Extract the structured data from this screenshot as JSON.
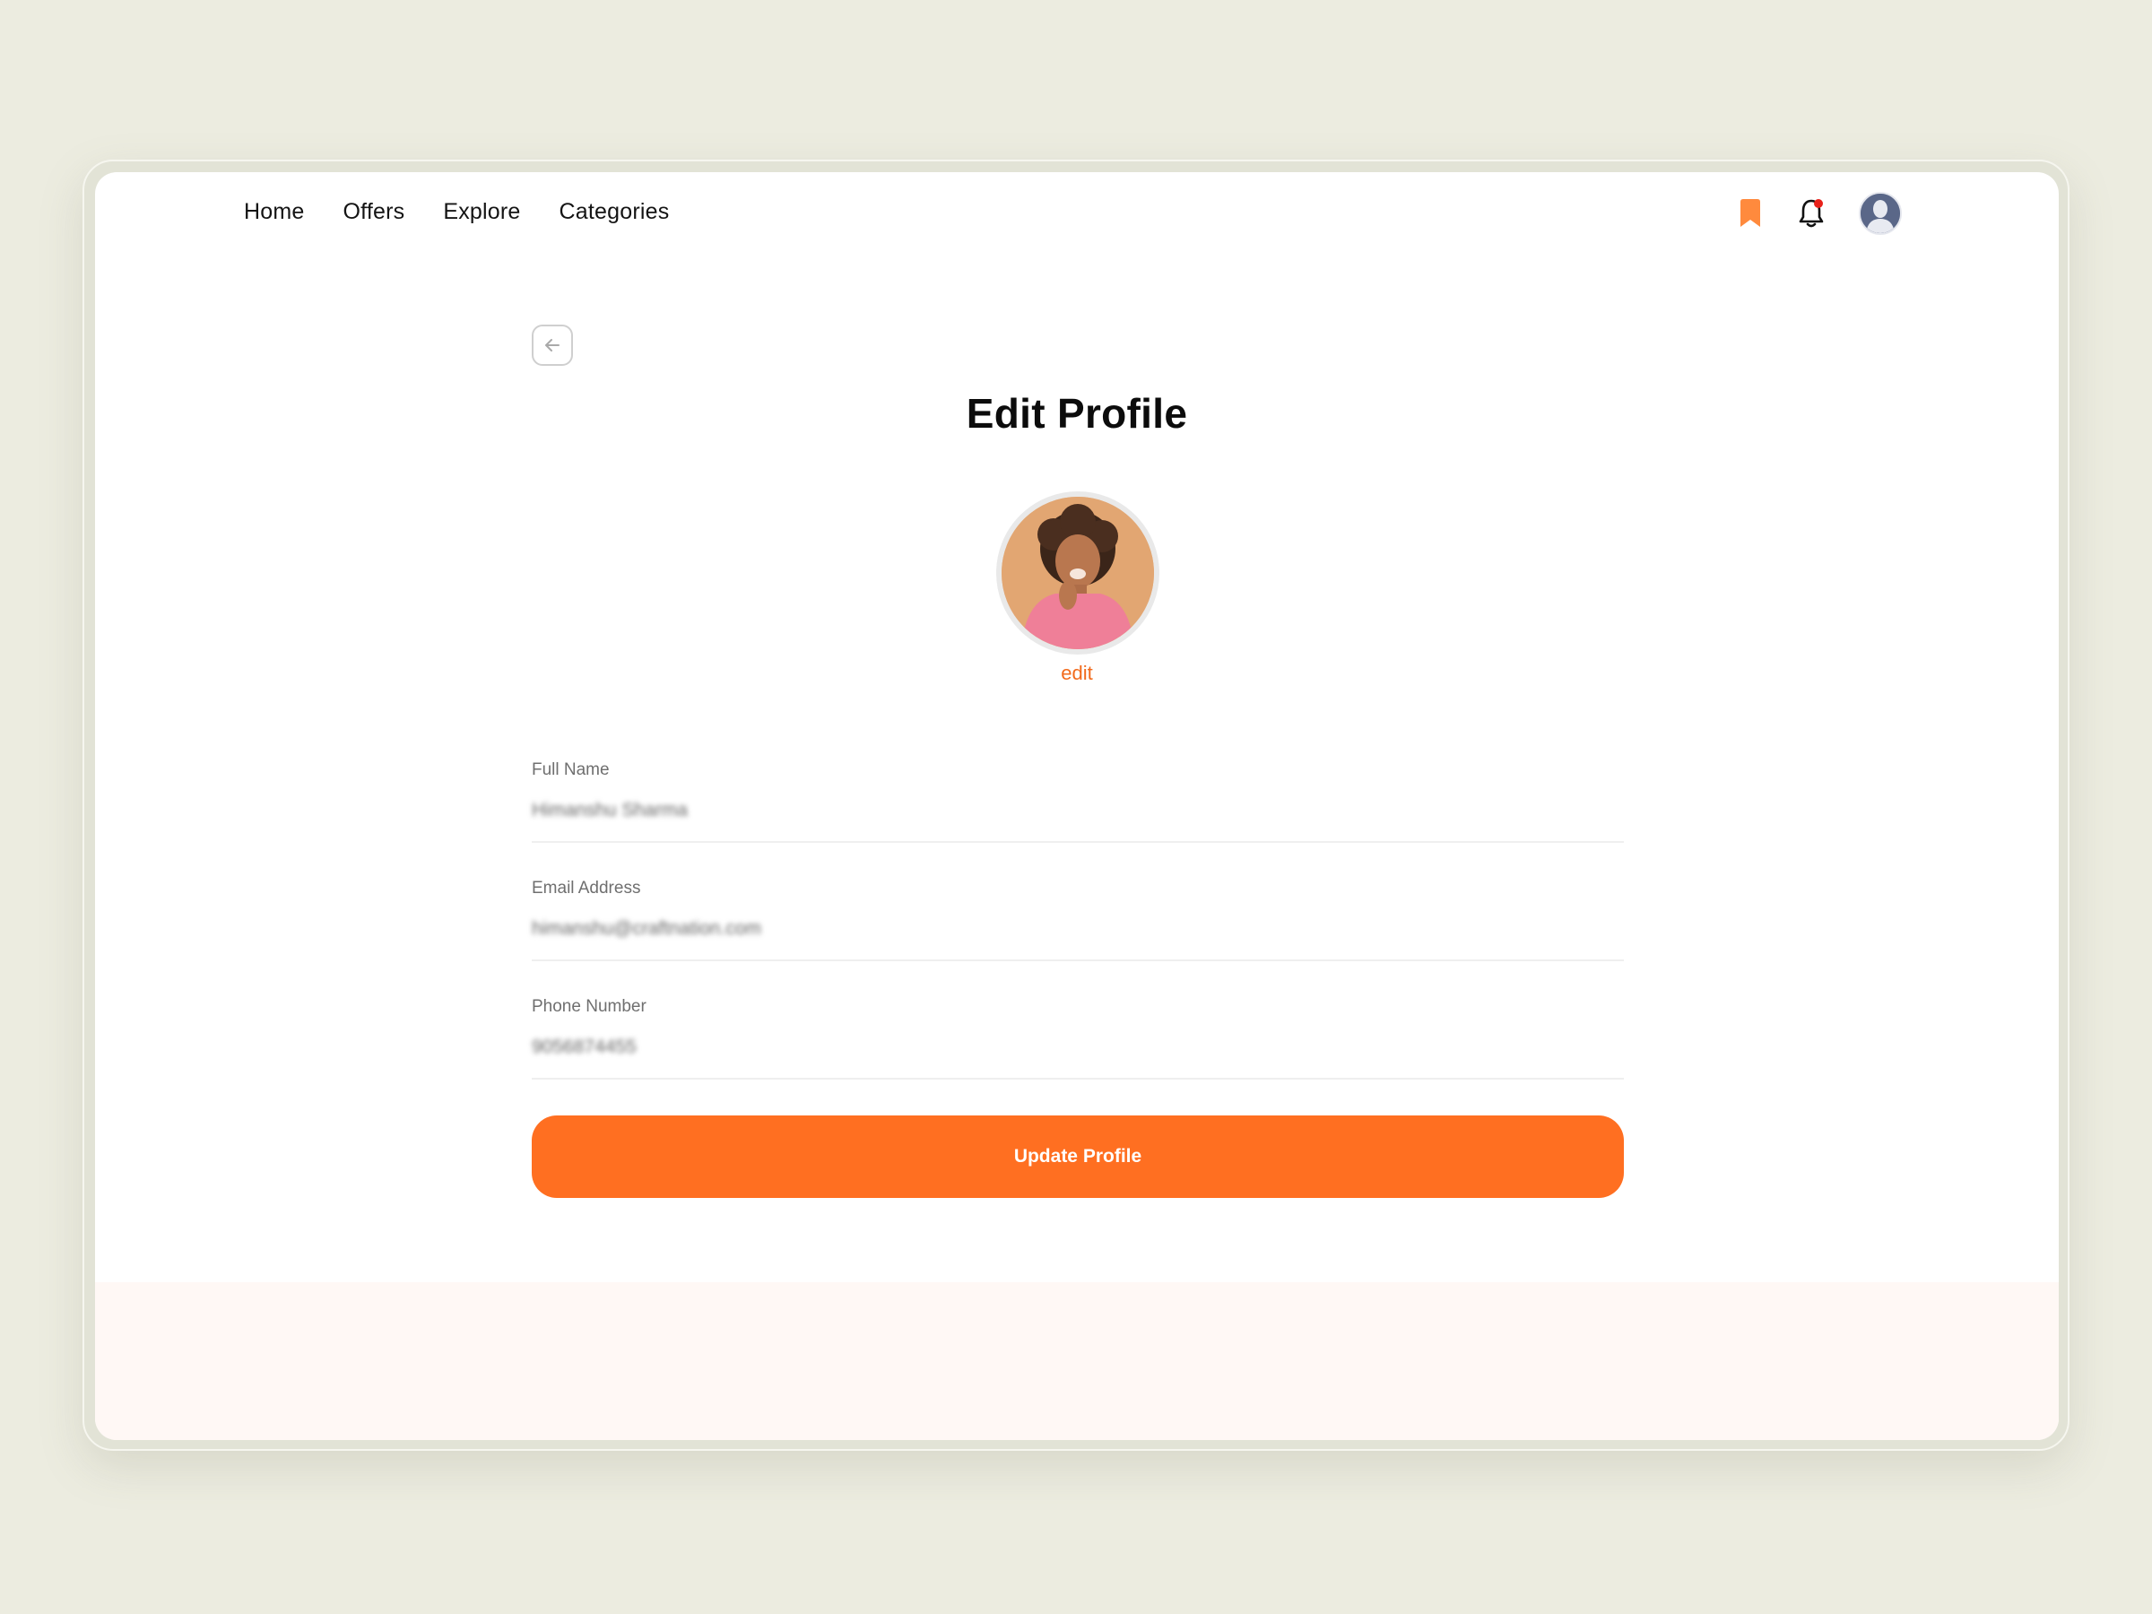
{
  "nav": {
    "items": [
      {
        "label": "Home"
      },
      {
        "label": "Offers"
      },
      {
        "label": "Explore"
      },
      {
        "label": "Categories"
      }
    ],
    "icons": {
      "bookmark": "bookmark-icon",
      "notifications": "bell-icon",
      "avatar": "user-avatar"
    },
    "notification_dot_color": "#e8211a",
    "bookmark_color": "#ff8a3d"
  },
  "page": {
    "title": "Edit Profile",
    "back_icon": "arrow-left-icon",
    "edit_photo_label": "edit"
  },
  "form": {
    "full_name": {
      "label": "Full Name",
      "value": "Himanshu Sharma"
    },
    "email": {
      "label": "Email Address",
      "value": "himanshu@craftnation.com"
    },
    "phone": {
      "label": "Phone Number",
      "value": "9056874455"
    }
  },
  "actions": {
    "update_label": "Update Profile"
  },
  "colors": {
    "accent": "#ff6f21",
    "background": "#ecece0"
  }
}
